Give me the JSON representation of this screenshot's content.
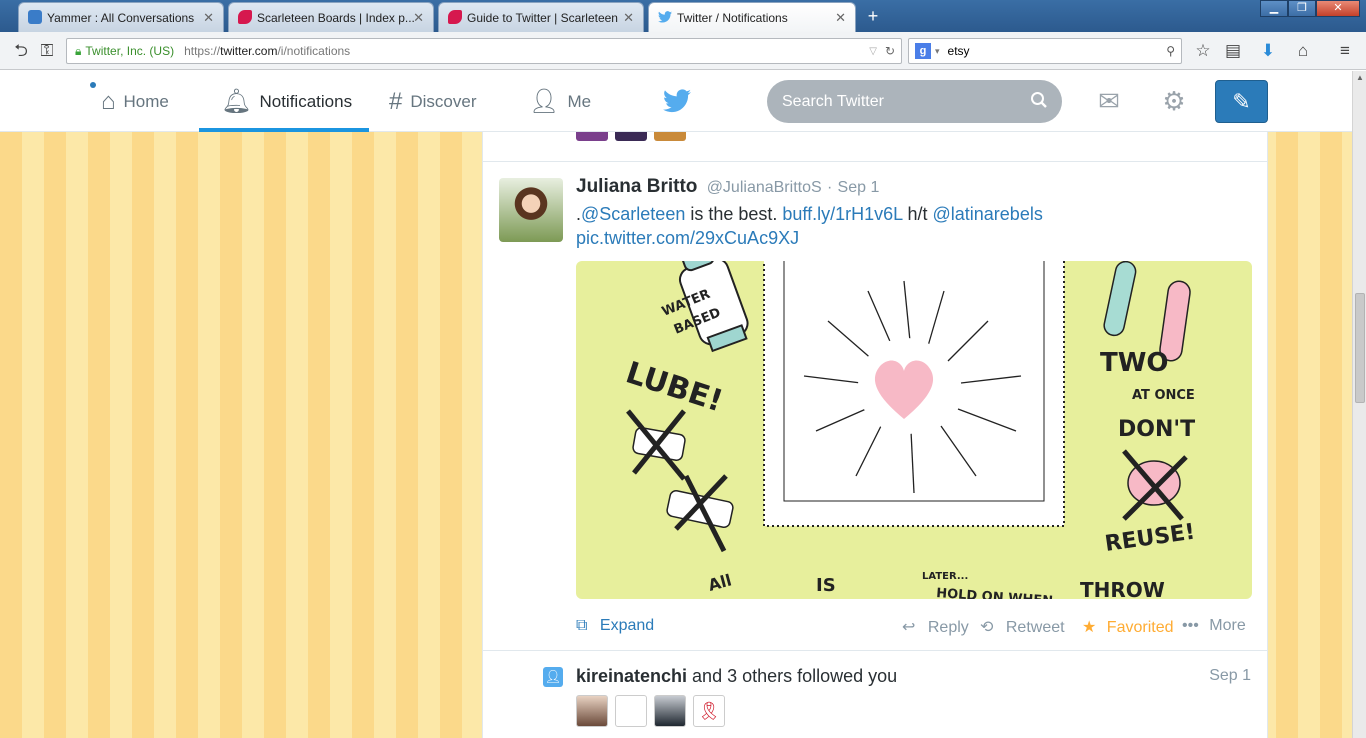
{
  "browser": {
    "tabs": [
      {
        "title": "Yammer : All Conversations",
        "icon": "yammer-icon"
      },
      {
        "title": "Scarleteen Boards | Index p...",
        "icon": "scarleteen-icon"
      },
      {
        "title": "Guide to Twitter | Scarleteen",
        "icon": "scarleteen-icon"
      },
      {
        "title": "Twitter / Notifications",
        "icon": "twitter-bird-icon",
        "active": true
      }
    ],
    "new_tab": "+",
    "identity": "Twitter, Inc. (US)",
    "url_prefix": "https://",
    "url_domain": "twitter.com",
    "url_path": "/i/notifications",
    "search_value": "etsy"
  },
  "twitter": {
    "nav": [
      {
        "label": "Home",
        "icon": "home-icon"
      },
      {
        "label": "Notifications",
        "icon": "bell-icon",
        "active": true
      },
      {
        "label": "Discover",
        "icon": "hash-icon"
      },
      {
        "label": "Me",
        "icon": "person-icon"
      }
    ],
    "search_placeholder": "Search Twitter",
    "accent": "#2b7bb9"
  },
  "tweet": {
    "name": "Juliana Britto",
    "handle": "@JulianaBrittoS",
    "sep": "·",
    "date": "Sep 1",
    "text_pre": ".",
    "mention1": "@Scarleteen",
    "text_mid": " is the best. ",
    "link": "buff.ly/1rH1v6L",
    "text_ht": " h/t ",
    "mention2": "@latinarebels",
    "pic": "pic.twitter.com/29xCuAc9XJ",
    "media": {
      "lube": "LUBE!",
      "water": "WATER",
      "based": "BASED",
      "two": "TWO",
      "at_once": "AT ONCE",
      "dont": "DON'T",
      "reuse": "REUSE!",
      "all": "All",
      "is": "IS",
      "later": "LATER...",
      "hold": "HOLD ON WHEN",
      "throw": "THROW"
    },
    "actions": {
      "expand": "Expand",
      "reply": "Reply",
      "retweet": "Retweet",
      "favorited": "Favorited",
      "more": "More"
    }
  },
  "follow": {
    "user": "kireinatenchi",
    "rest": " and 3 others followed you",
    "date": "Sep 1"
  }
}
